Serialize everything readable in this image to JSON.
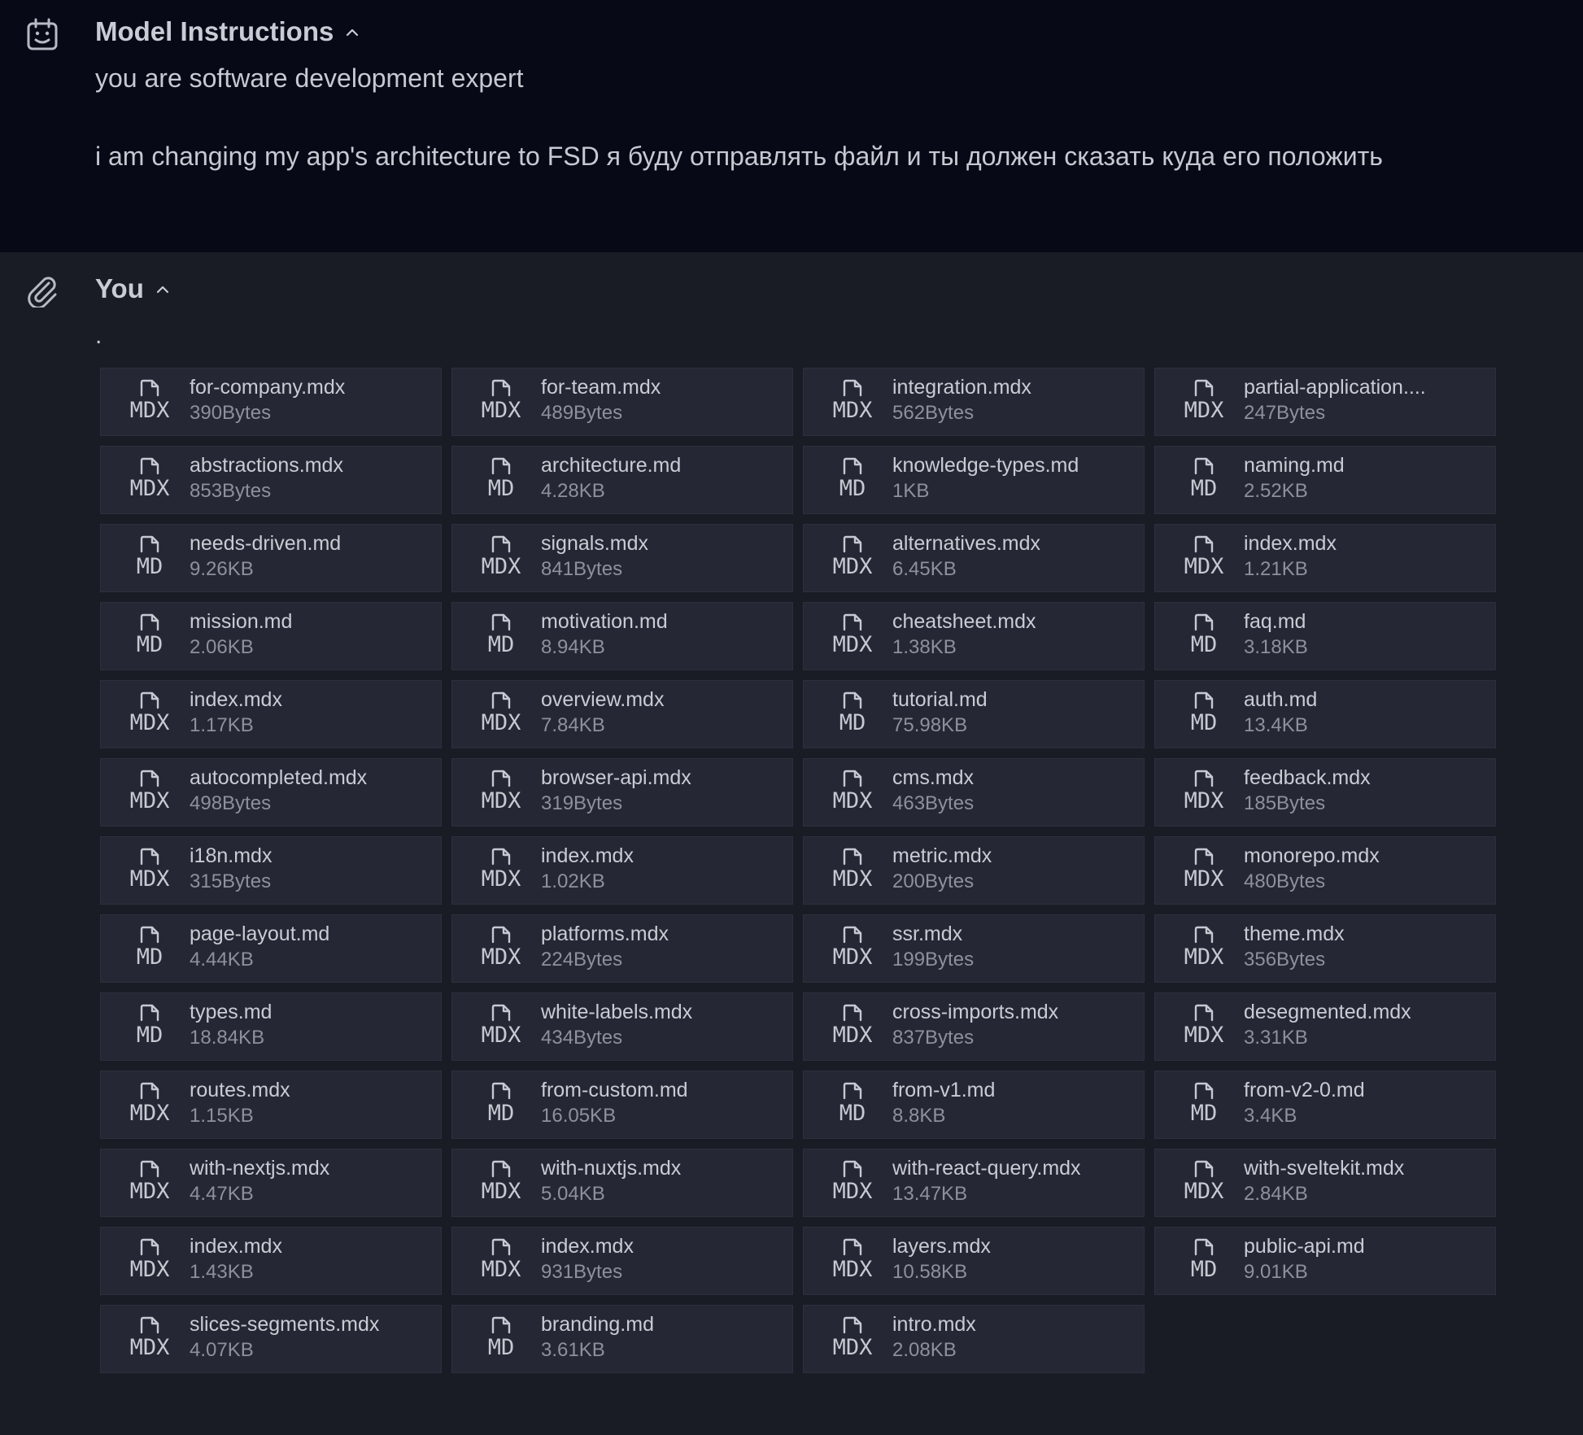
{
  "system": {
    "icon": "robot-calendar-icon",
    "title": "Model Instructions",
    "line1": "you are software development expert",
    "line2": "i am changing my app's architecture to FSD я буду отправлять файл и ты должен сказать куда его положить"
  },
  "user": {
    "icon": "paperclip-icon",
    "title": "You",
    "message": ".",
    "files": [
      {
        "name": "for-company.mdx",
        "ext": "MDX",
        "size": "390Bytes"
      },
      {
        "name": "for-team.mdx",
        "ext": "MDX",
        "size": "489Bytes"
      },
      {
        "name": "integration.mdx",
        "ext": "MDX",
        "size": "562Bytes"
      },
      {
        "name": "partial-application....",
        "ext": "MDX",
        "size": "247Bytes"
      },
      {
        "name": "abstractions.mdx",
        "ext": "MDX",
        "size": "853Bytes"
      },
      {
        "name": "architecture.md",
        "ext": "MD",
        "size": "4.28KB"
      },
      {
        "name": "knowledge-types.md",
        "ext": "MD",
        "size": "1KB"
      },
      {
        "name": "naming.md",
        "ext": "MD",
        "size": "2.52KB"
      },
      {
        "name": "needs-driven.md",
        "ext": "MD",
        "size": "9.26KB"
      },
      {
        "name": "signals.mdx",
        "ext": "MDX",
        "size": "841Bytes"
      },
      {
        "name": "alternatives.mdx",
        "ext": "MDX",
        "size": "6.45KB"
      },
      {
        "name": "index.mdx",
        "ext": "MDX",
        "size": "1.21KB"
      },
      {
        "name": "mission.md",
        "ext": "MD",
        "size": "2.06KB"
      },
      {
        "name": "motivation.md",
        "ext": "MD",
        "size": "8.94KB"
      },
      {
        "name": "cheatsheet.mdx",
        "ext": "MDX",
        "size": "1.38KB"
      },
      {
        "name": "faq.md",
        "ext": "MD",
        "size": "3.18KB"
      },
      {
        "name": "index.mdx",
        "ext": "MDX",
        "size": "1.17KB"
      },
      {
        "name": "overview.mdx",
        "ext": "MDX",
        "size": "7.84KB"
      },
      {
        "name": "tutorial.md",
        "ext": "MD",
        "size": "75.98KB"
      },
      {
        "name": "auth.md",
        "ext": "MD",
        "size": "13.4KB"
      },
      {
        "name": "autocompleted.mdx",
        "ext": "MDX",
        "size": "498Bytes"
      },
      {
        "name": "browser-api.mdx",
        "ext": "MDX",
        "size": "319Bytes"
      },
      {
        "name": "cms.mdx",
        "ext": "MDX",
        "size": "463Bytes"
      },
      {
        "name": "feedback.mdx",
        "ext": "MDX",
        "size": "185Bytes"
      },
      {
        "name": "i18n.mdx",
        "ext": "MDX",
        "size": "315Bytes"
      },
      {
        "name": "index.mdx",
        "ext": "MDX",
        "size": "1.02KB"
      },
      {
        "name": "metric.mdx",
        "ext": "MDX",
        "size": "200Bytes"
      },
      {
        "name": "monorepo.mdx",
        "ext": "MDX",
        "size": "480Bytes"
      },
      {
        "name": "page-layout.md",
        "ext": "MD",
        "size": "4.44KB"
      },
      {
        "name": "platforms.mdx",
        "ext": "MDX",
        "size": "224Bytes"
      },
      {
        "name": "ssr.mdx",
        "ext": "MDX",
        "size": "199Bytes"
      },
      {
        "name": "theme.mdx",
        "ext": "MDX",
        "size": "356Bytes"
      },
      {
        "name": "types.md",
        "ext": "MD",
        "size": "18.84KB"
      },
      {
        "name": "white-labels.mdx",
        "ext": "MDX",
        "size": "434Bytes"
      },
      {
        "name": "cross-imports.mdx",
        "ext": "MDX",
        "size": "837Bytes"
      },
      {
        "name": "desegmented.mdx",
        "ext": "MDX",
        "size": "3.31KB"
      },
      {
        "name": "routes.mdx",
        "ext": "MDX",
        "size": "1.15KB"
      },
      {
        "name": "from-custom.md",
        "ext": "MD",
        "size": "16.05KB"
      },
      {
        "name": "from-v1.md",
        "ext": "MD",
        "size": "8.8KB"
      },
      {
        "name": "from-v2-0.md",
        "ext": "MD",
        "size": "3.4KB"
      },
      {
        "name": "with-nextjs.mdx",
        "ext": "MDX",
        "size": "4.47KB"
      },
      {
        "name": "with-nuxtjs.mdx",
        "ext": "MDX",
        "size": "5.04KB"
      },
      {
        "name": "with-react-query.mdx",
        "ext": "MDX",
        "size": "13.47KB"
      },
      {
        "name": "with-sveltekit.mdx",
        "ext": "MDX",
        "size": "2.84KB"
      },
      {
        "name": "index.mdx",
        "ext": "MDX",
        "size": "1.43KB"
      },
      {
        "name": "index.mdx",
        "ext": "MDX",
        "size": "931Bytes"
      },
      {
        "name": "layers.mdx",
        "ext": "MDX",
        "size": "10.58KB"
      },
      {
        "name": "public-api.md",
        "ext": "MD",
        "size": "9.01KB"
      },
      {
        "name": "slices-segments.mdx",
        "ext": "MDX",
        "size": "4.07KB"
      },
      {
        "name": "branding.md",
        "ext": "MD",
        "size": "3.61KB"
      },
      {
        "name": "intro.mdx",
        "ext": "MDX",
        "size": "2.08KB"
      }
    ]
  },
  "colors": {
    "system_bg": "#070a16",
    "user_bg": "#1a1c25",
    "tile_bg": "#252834",
    "text": "#c6c9d1",
    "muted": "#8d919c"
  }
}
